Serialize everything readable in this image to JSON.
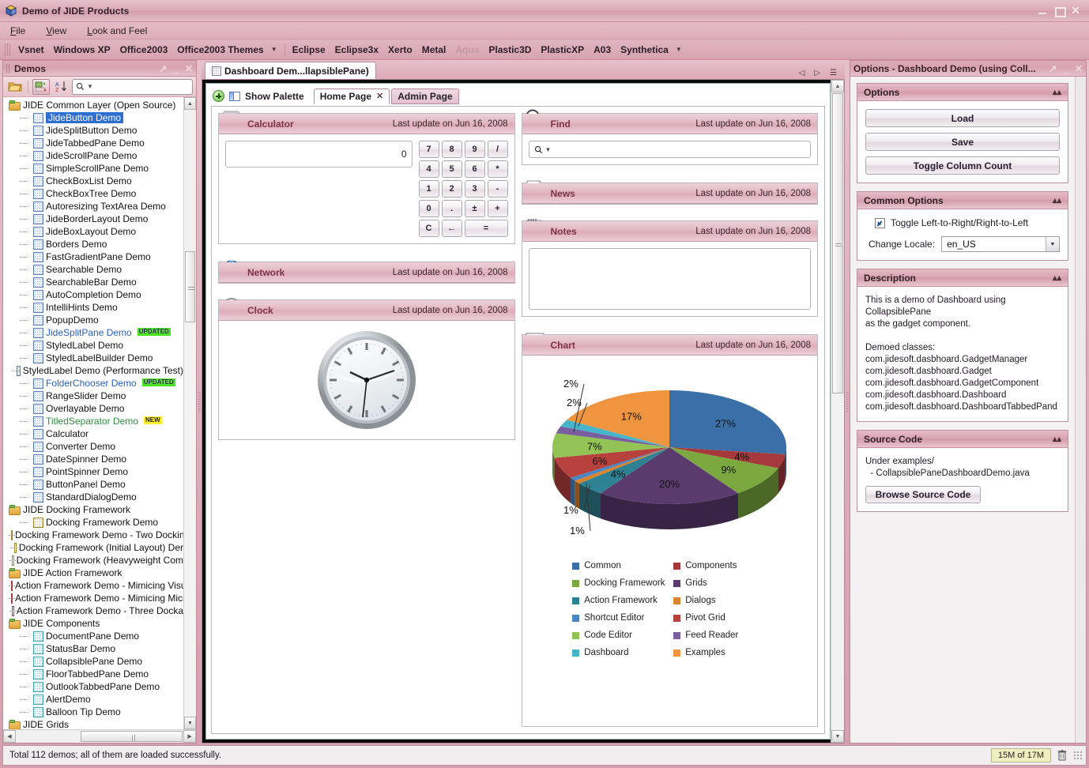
{
  "window": {
    "title": "Demo of JIDE Products",
    "icon": "jide-cube-icon"
  },
  "menubar": {
    "items": [
      "File",
      "View",
      "Look and Feel"
    ]
  },
  "laf_toolbar": {
    "items": [
      {
        "label": "Vsnet",
        "disabled": false
      },
      {
        "label": "Windows XP",
        "disabled": false
      },
      {
        "label": "Office2003",
        "disabled": false
      },
      {
        "label": "Office2003 Themes",
        "disabled": false
      },
      {
        "label": "Eclipse",
        "disabled": false
      },
      {
        "label": "Eclipse3x",
        "disabled": false
      },
      {
        "label": "Xerto",
        "disabled": false
      },
      {
        "label": "Metal",
        "disabled": false
      },
      {
        "label": "Aqua",
        "disabled": true
      },
      {
        "label": "Plastic3D",
        "disabled": false
      },
      {
        "label": "PlasticXP",
        "disabled": false
      },
      {
        "label": "A03",
        "disabled": false
      },
      {
        "label": "Synthetica",
        "disabled": false
      }
    ],
    "dropdown_glyph": "▼"
  },
  "left_dock": {
    "title": "Demos",
    "toolbar": {
      "open_icon": "open-folder-icon",
      "expand_icon": "expand-tree-icon",
      "sort_icon": "sort-az-icon"
    },
    "search": {
      "value": "",
      "placeholder": ""
    },
    "tree": [
      {
        "label": "JIDE Common Layer (Open Source)",
        "type": "folder",
        "indent": 0
      },
      {
        "label": "JideButton Demo",
        "type": "leaf",
        "indent": 1,
        "selected": true
      },
      {
        "label": "JideSplitButton Demo",
        "type": "leaf",
        "indent": 1
      },
      {
        "label": "JideTabbedPane Demo",
        "type": "leaf",
        "indent": 1
      },
      {
        "label": "JideScrollPane Demo",
        "type": "leaf",
        "indent": 1
      },
      {
        "label": "SimpleScrollPane Demo",
        "type": "leaf",
        "indent": 1
      },
      {
        "label": "CheckBoxList Demo",
        "type": "leaf",
        "indent": 1
      },
      {
        "label": "CheckBoxTree Demo",
        "type": "leaf",
        "indent": 1
      },
      {
        "label": "Autoresizing TextArea Demo",
        "type": "leaf",
        "indent": 1
      },
      {
        "label": "JideBorderLayout Demo",
        "type": "leaf",
        "indent": 1
      },
      {
        "label": "JideBoxLayout Demo",
        "type": "leaf",
        "indent": 1
      },
      {
        "label": "Borders Demo",
        "type": "leaf",
        "indent": 1
      },
      {
        "label": "FastGradientPane Demo",
        "type": "leaf",
        "indent": 1
      },
      {
        "label": "Searchable Demo",
        "type": "leaf",
        "indent": 1
      },
      {
        "label": "SearchableBar Demo",
        "type": "leaf",
        "indent": 1
      },
      {
        "label": "AutoCompletion Demo",
        "type": "leaf",
        "indent": 1
      },
      {
        "label": "IntelliHints Demo",
        "type": "leaf",
        "indent": 1
      },
      {
        "label": "PopupDemo",
        "type": "leaf",
        "indent": 1
      },
      {
        "label": "JideSplitPane Demo",
        "type": "leaf",
        "indent": 1,
        "color": "blue",
        "badge": "UPDATED"
      },
      {
        "label": "StyledLabel Demo",
        "type": "leaf",
        "indent": 1
      },
      {
        "label": "StyledLabelBuilder Demo",
        "type": "leaf",
        "indent": 1
      },
      {
        "label": "StyledLabel Demo (Performance Test)",
        "type": "leaf",
        "indent": 1
      },
      {
        "label": "FolderChooser Demo",
        "type": "leaf",
        "indent": 1,
        "color": "blue",
        "badge": "UPDATED"
      },
      {
        "label": "RangeSlider Demo",
        "type": "leaf",
        "indent": 1
      },
      {
        "label": "Overlayable Demo",
        "type": "leaf",
        "indent": 1
      },
      {
        "label": "TitledSeparator Demo",
        "type": "leaf",
        "indent": 1,
        "color": "green",
        "badge": "NEW"
      },
      {
        "label": "Calculator",
        "type": "leaf",
        "indent": 1
      },
      {
        "label": "Converter Demo",
        "type": "leaf",
        "indent": 1
      },
      {
        "label": "DateSpinner Demo",
        "type": "leaf",
        "indent": 1
      },
      {
        "label": "PointSpinner Demo",
        "type": "leaf",
        "indent": 1
      },
      {
        "label": "ButtonPanel Demo",
        "type": "leaf",
        "indent": 1
      },
      {
        "label": "StandardDialogDemo",
        "type": "leaf",
        "indent": 1
      },
      {
        "label": "JIDE Docking Framework",
        "type": "folder",
        "indent": 0
      },
      {
        "label": "Docking Framework Demo",
        "type": "leaf",
        "indent": 1,
        "icon": "amber"
      },
      {
        "label": "Docking Framework Demo - Two Dockin",
        "type": "leaf",
        "indent": 1,
        "icon": "amber"
      },
      {
        "label": "Docking Framework (Initial Layout) Der",
        "type": "leaf",
        "indent": 1,
        "icon": "amber"
      },
      {
        "label": "Docking Framework (Heavyweight Com",
        "type": "leaf",
        "indent": 1,
        "icon": "amber"
      },
      {
        "label": "JIDE Action Framework",
        "type": "folder",
        "indent": 0
      },
      {
        "label": "Action Framework Demo - Mimicing Visu",
        "type": "leaf",
        "indent": 1,
        "icon": "red"
      },
      {
        "label": "Action Framework Demo - Mimicing Micr",
        "type": "leaf",
        "indent": 1,
        "icon": "red"
      },
      {
        "label": "Action Framework Demo - Three Docka",
        "type": "leaf",
        "indent": 1,
        "icon": "red"
      },
      {
        "label": "JIDE Components",
        "type": "folder",
        "indent": 0
      },
      {
        "label": "DocumentPane Demo",
        "type": "leaf",
        "indent": 1,
        "icon": "teal"
      },
      {
        "label": "StatusBar Demo",
        "type": "leaf",
        "indent": 1,
        "icon": "teal"
      },
      {
        "label": "CollapsiblePane Demo",
        "type": "leaf",
        "indent": 1,
        "icon": "teal"
      },
      {
        "label": "FloorTabbedPane Demo",
        "type": "leaf",
        "indent": 1,
        "icon": "teal"
      },
      {
        "label": "OutlookTabbedPane Demo",
        "type": "leaf",
        "indent": 1,
        "icon": "teal"
      },
      {
        "label": "AlertDemo",
        "type": "leaf",
        "indent": 1,
        "icon": "teal"
      },
      {
        "label": "Balloon Tip Demo",
        "type": "leaf",
        "indent": 1,
        "icon": "teal"
      },
      {
        "label": "JIDE Grids",
        "type": "folder",
        "indent": 0,
        "clipped": true
      }
    ]
  },
  "document": {
    "tab_label": "Dashboard Dem...llapsiblePane)",
    "tab_icon": "grid-icon",
    "controls": [
      "prev-tab-icon",
      "next-tab-icon",
      "tab-list-icon"
    ]
  },
  "dashboard": {
    "show_palette_label": "Show Palette",
    "tabs": [
      {
        "label": "Home Page",
        "active": true,
        "closable": true
      },
      {
        "label": "Admin Page",
        "active": false,
        "closable": false
      }
    ],
    "last_update": "Last update on Jun 16, 2008",
    "gadgets": {
      "calculator": {
        "title": "Calculator",
        "icon": "calculator-icon",
        "display_value": "0",
        "keys": [
          "7",
          "8",
          "9",
          "/",
          "4",
          "5",
          "6",
          "*",
          "1",
          "2",
          "3",
          "-",
          "0",
          ".",
          "±",
          "+",
          "C",
          "←",
          "="
        ]
      },
      "network": {
        "title": "Network",
        "icon": "globe-icon"
      },
      "clock": {
        "title": "Clock",
        "icon": "clock-icon"
      },
      "find": {
        "title": "Find",
        "icon": "magnifier-icon",
        "search_value": "",
        "search_placeholder": ""
      },
      "news": {
        "title": "News",
        "icon": "newspaper-icon"
      },
      "notes": {
        "title": "Notes",
        "icon": "notepad-pencil-icon",
        "text": ""
      },
      "chart": {
        "title": "Chart",
        "icon": "barchart-icon"
      }
    }
  },
  "chart_data": {
    "type": "pie",
    "title": "Chart",
    "legend_position": "bottom",
    "labels": [
      "Common",
      "Components",
      "Docking Framework",
      "Grids",
      "Action Framework",
      "Dialogs",
      "Shortcut Editor",
      "Pivot Grid",
      "Code Editor",
      "Feed Reader",
      "Dashboard",
      "Examples"
    ],
    "values": [
      27,
      4,
      9,
      20,
      4,
      1,
      1,
      6,
      7,
      2,
      2,
      17
    ],
    "value_labels": [
      "27%",
      "4%",
      "9%",
      "20%",
      "4%",
      "1%",
      "1%",
      "6%",
      "7%",
      "2%",
      "2%",
      "17%"
    ],
    "colors": [
      "#3a6fa8",
      "#a6393c",
      "#7ba93f",
      "#5b3b6e",
      "#2f8294",
      "#d9832f",
      "#4a86c4",
      "#b8413e",
      "#93c255",
      "#7a5fa0",
      "#45b6c9",
      "#f0953f"
    ],
    "units": "percent"
  },
  "options_dock": {
    "title": "Options - Dashboard Demo (using Coll...",
    "panels": {
      "options": {
        "header": "Options",
        "buttons": [
          "Load",
          "Save",
          "Toggle Column Count"
        ]
      },
      "common": {
        "header": "Common Options",
        "checkbox_label": "Toggle Left-to-Right/Right-to-Left",
        "checkbox_checked": true,
        "locale_label": "Change Locale:",
        "locale_value": "en_US"
      },
      "description": {
        "header": "Description",
        "lines": [
          "This is a demo of Dashboard using CollapsiblePane",
          "as the gadget component.",
          "",
          "Demoed classes:",
          "com.jidesoft.dasbhoard.GadgetManager",
          "com.jidesoft.dasbhoard.Gadget",
          "com.jidesoft.dasbhoard.GadgetComponent",
          "com.jidesoft.dasbhoard.Dashboard",
          "com.jidesoft.dasbhoard.DashboardTabbedPand"
        ]
      },
      "source": {
        "header": "Source Code",
        "lines": [
          "Under examples/",
          "  - CollapsiblePaneDashboardDemo.java"
        ],
        "button": "Browse Source Code"
      }
    }
  },
  "statusbar": {
    "message": "Total 112 demos; all of them are loaded successfully.",
    "memory": "15M of 17M",
    "trash_icon": "trash-icon"
  },
  "colors": {
    "accent": "#d9a7b4",
    "header_text": "#7d3347",
    "selection": "#2f6fd0"
  }
}
